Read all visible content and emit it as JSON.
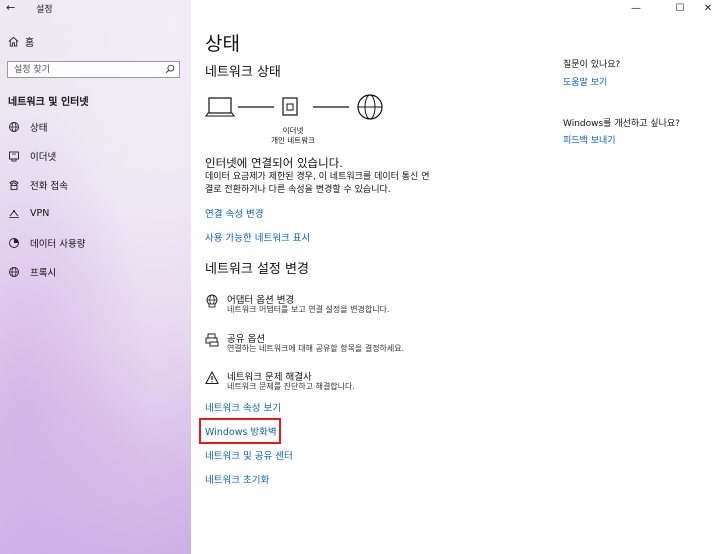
{
  "window": {
    "title": "설정",
    "back_glyph": "←",
    "minimize_glyph": "—",
    "maximize_glyph": "☐",
    "close_glyph": "✕"
  },
  "sidebar": {
    "home_label": "홈",
    "search_placeholder": "설정 찾기",
    "section_heading": "네트워크 및 인터넷",
    "items": [
      {
        "label": "상태",
        "icon": "globe-status-icon"
      },
      {
        "label": "이더넷",
        "icon": "ethernet-icon"
      },
      {
        "label": "전화 접속",
        "icon": "phone-icon"
      },
      {
        "label": "VPN",
        "icon": "vpn-icon"
      },
      {
        "label": "데이터 사용량",
        "icon": "data-usage-icon"
      },
      {
        "label": "프록시",
        "icon": "globe-icon"
      }
    ]
  },
  "main": {
    "page_title": "상태",
    "network_status_heading": "네트워크 상태",
    "diagram": {
      "adapter_label": "이더넷",
      "network_label": "개인 네트워크"
    },
    "status_title": "인터넷에 연결되어 있습니다.",
    "status_desc": "데이터 요금제가 제한된 경우, 이 네트워크를 데이터 통신 연결로 전환하거나 다른 속성을 변경할 수 있습니다.",
    "links_top": {
      "change_props": "연결 속성 변경",
      "show_networks": "사용 가능한 네트워크 표시"
    },
    "change_settings_heading": "네트워크 설정 변경",
    "options": [
      {
        "title": "어댑터 옵션 변경",
        "desc": "네트워크 어댑터를 보고 연결 설정을 변경합니다.",
        "icon": "adapter-globe-icon"
      },
      {
        "title": "공유 옵션",
        "desc": "연결하는 네트워크에 대해 공유할 항목을 결정하세요.",
        "icon": "sharing-printer-icon"
      },
      {
        "title": "네트워크 문제 해결사",
        "desc": "네트워크 문제를 진단하고 해결합니다.",
        "icon": "warning-icon"
      }
    ],
    "links_bottom": {
      "view_props": "네트워크 속성 보기",
      "firewall": "Windows 방화벽",
      "sharing_center": "네트워크 및 공유 센터",
      "reset": "네트워크 초기화"
    }
  },
  "right_panel": {
    "question_label": "질문이 있나요?",
    "help_link": "도움말 보기",
    "improve_label": "Windows를 개선하고 싶나요?",
    "feedback_link": "피드백 보내기"
  },
  "colors": {
    "link": "#0a64b4",
    "highlight": "#e01c1c"
  }
}
